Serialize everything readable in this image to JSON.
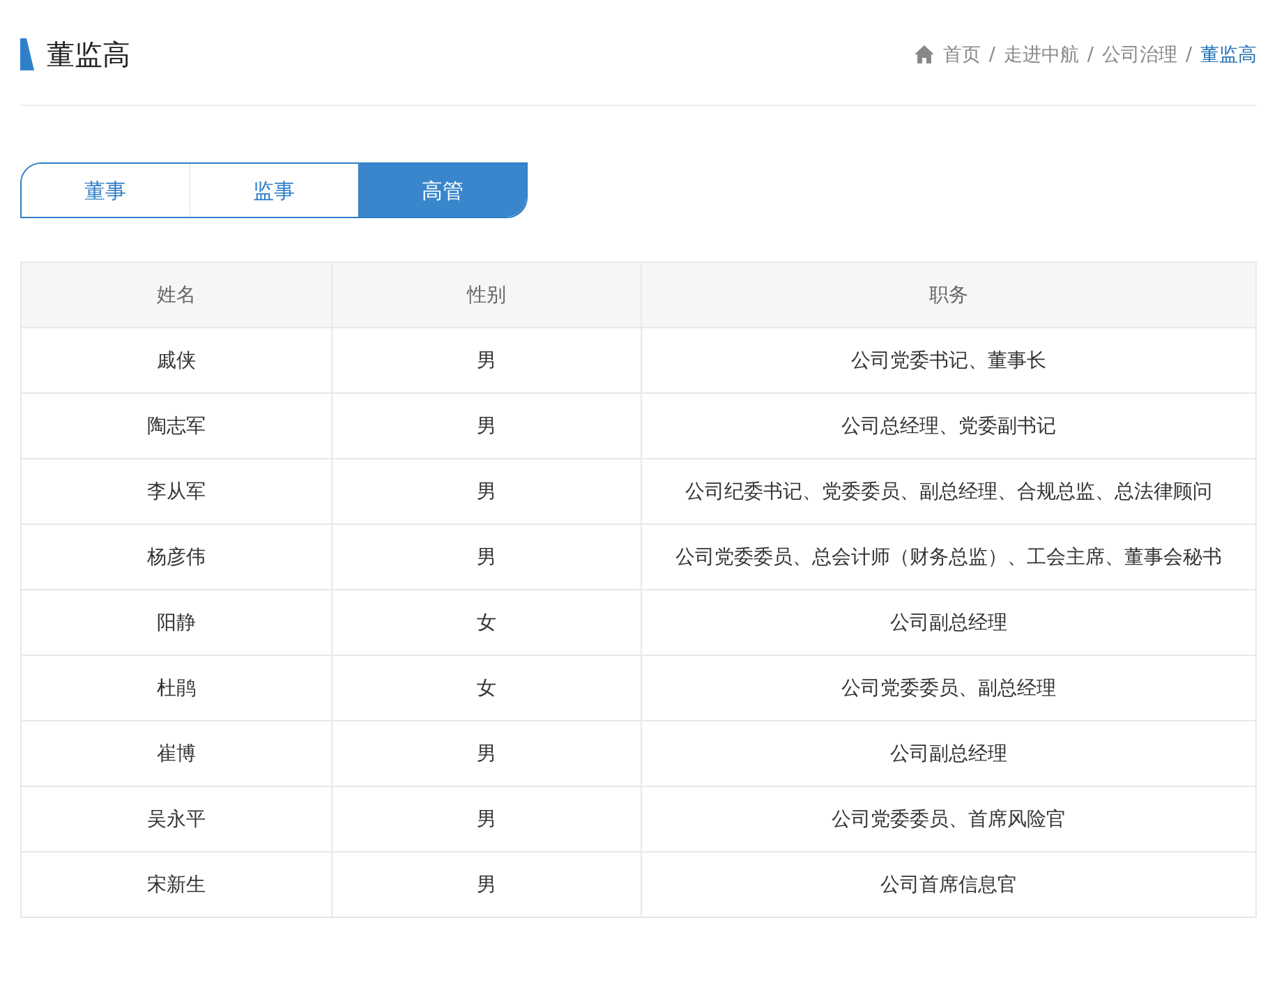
{
  "page_title": "董监高",
  "breadcrumb": [
    {
      "label": "首页",
      "selected": false
    },
    {
      "label": "走进中航",
      "selected": false
    },
    {
      "label": "公司治理",
      "selected": false
    },
    {
      "label": "董监高",
      "selected": true
    }
  ],
  "breadcrumb_separator": "/",
  "tabs": [
    {
      "label": "董事",
      "selected": false
    },
    {
      "label": "监事",
      "selected": false
    },
    {
      "label": "高管",
      "selected": true
    }
  ],
  "table": {
    "columns": [
      "姓名",
      "性别",
      "职务"
    ],
    "rows": [
      [
        "戚侠",
        "男",
        "公司党委书记、董事长"
      ],
      [
        "陶志军",
        "男",
        "公司总经理、党委副书记"
      ],
      [
        "李从军",
        "男",
        "公司纪委书记、党委委员、副总经理、合规总监、总法律顾问"
      ],
      [
        "杨彦伟",
        "男",
        "公司党委委员、总会计师（财务总监）、工会主席、董事会秘书"
      ],
      [
        "阳静",
        "女",
        "公司副总经理"
      ],
      [
        "杜鹃",
        "女",
        "公司党委委员、副总经理"
      ],
      [
        "崔博",
        "男",
        "公司副总经理"
      ],
      [
        "吴永平",
        "男",
        "公司党委委员、首席风险官"
      ],
      [
        "宋新生",
        "男",
        "公司首席信息官"
      ]
    ]
  }
}
